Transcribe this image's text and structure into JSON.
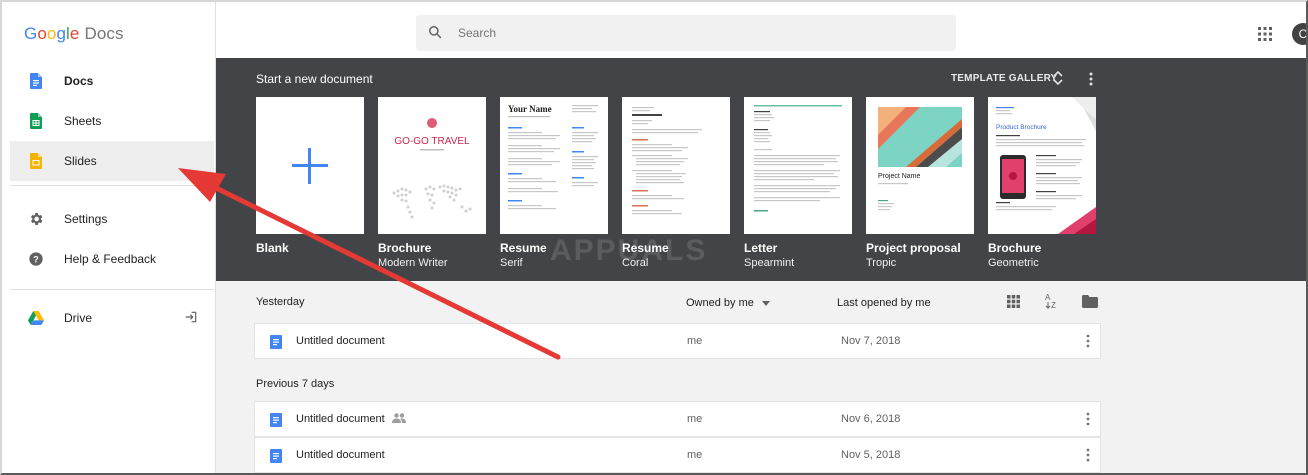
{
  "app": {
    "brand_letters": [
      {
        "ch": "G",
        "color": "#4285F4"
      },
      {
        "ch": "o",
        "color": "#EA4335"
      },
      {
        "ch": "o",
        "color": "#FBBC05"
      },
      {
        "ch": "g",
        "color": "#4285F4"
      },
      {
        "ch": "l",
        "color": "#34A853"
      },
      {
        "ch": "e",
        "color": "#EA4335"
      }
    ],
    "product_name": "Docs"
  },
  "sidebar": {
    "items": [
      {
        "label": "Docs",
        "icon": "docs-icon",
        "color": "#4285F4"
      },
      {
        "label": "Sheets",
        "icon": "sheets-icon",
        "color": "#0F9D58"
      },
      {
        "label": "Slides",
        "icon": "slides-icon",
        "color": "#F4B400"
      },
      {
        "label": "Settings",
        "icon": "gear-icon"
      },
      {
        "label": "Help & Feedback",
        "icon": "help-icon"
      },
      {
        "label": "Drive",
        "icon": "drive-icon"
      }
    ]
  },
  "search": {
    "placeholder": "Search"
  },
  "gallery": {
    "title": "Start a new document",
    "link": "TEMPLATE GALLERY",
    "templates": [
      {
        "name": "Blank",
        "sub": ""
      },
      {
        "name": "Brochure",
        "sub": "Modern Writer",
        "thumb_text": "GO-GO TRAVEL"
      },
      {
        "name": "Resume",
        "sub": "Serif",
        "thumb_text": "Your Name"
      },
      {
        "name": "Resume",
        "sub": "Coral"
      },
      {
        "name": "Letter",
        "sub": "Spearmint"
      },
      {
        "name": "Project proposal",
        "sub": "Tropic",
        "thumb_text": "Project Name"
      },
      {
        "name": "Brochure",
        "sub": "Geometric",
        "thumb_text": "Product Brochure"
      }
    ]
  },
  "list": {
    "section_yesterday": "Yesterday",
    "section_prev": "Previous 7 days",
    "owned_by": "Owned by me",
    "last_opened": "Last opened by me",
    "rows": [
      {
        "title": "Untitled document",
        "owner": "me",
        "date": "Nov 7, 2018",
        "shared": false
      },
      {
        "title": "Untitled document",
        "owner": "me",
        "date": "Nov 6, 2018",
        "shared": true
      },
      {
        "title": "Untitled document",
        "owner": "me",
        "date": "Nov 5, 2018",
        "shared": false
      }
    ]
  },
  "annotation": {
    "arrow_color": "#E53935"
  },
  "watermark": "APPUALS",
  "avatar_letter": "C"
}
